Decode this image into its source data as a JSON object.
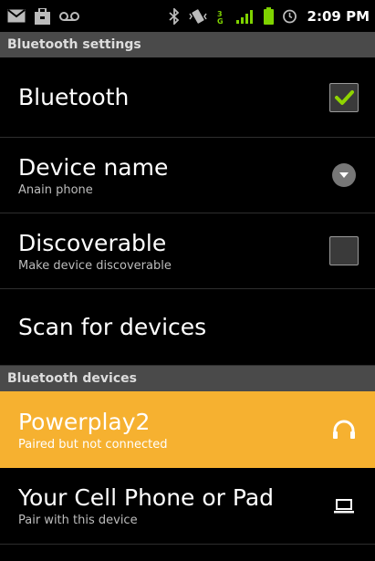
{
  "status_bar": {
    "time": "2:09 PM",
    "icons": [
      "mail-icon",
      "briefcase-icon",
      "voicemail-icon",
      "bluetooth-icon",
      "vibrate-icon",
      "data-3g-icon",
      "signal-icon",
      "battery-icon",
      "alarm-icon"
    ]
  },
  "header": {
    "title": "Bluetooth settings"
  },
  "settings": {
    "bluetooth": {
      "label": "Bluetooth",
      "checked": true
    },
    "device_name": {
      "label": "Device name",
      "value": "Anain phone"
    },
    "discoverable": {
      "label": "Discoverable",
      "summary": "Make device discoverable",
      "checked": false
    },
    "scan": {
      "label": "Scan for devices"
    }
  },
  "devices_header": {
    "title": "Bluetooth devices"
  },
  "devices": [
    {
      "name": "Powerplay2",
      "status": "Paired but not connected",
      "icon": "headphones-icon",
      "highlight_color": "#f6b130"
    },
    {
      "name": "Your Cell Phone or Pad",
      "status": "Pair with this device",
      "icon": "laptop-icon"
    }
  ],
  "colors": {
    "accent_check": "#8fd400",
    "highlight": "#f6b130"
  }
}
